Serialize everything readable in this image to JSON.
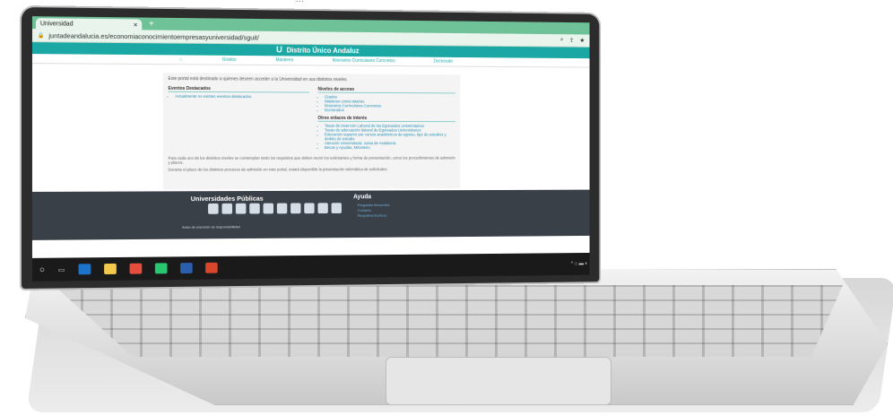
{
  "caption": "...",
  "browser": {
    "tab_title": "Universidad",
    "tab_close": "×",
    "new_tab": "+",
    "url": "juntadeandalucia.es/economiaconocimientoempresasyuniversidad/sguit/"
  },
  "site": {
    "title": "Distrito Único Andaluz",
    "nav": [
      "Grados",
      "Másteres",
      "Itinerarios Curriculares Concretos",
      "Doctorado"
    ],
    "intro": "Este portal está destinado a quienes deseen acceder a la Universidad en sus distintos niveles.",
    "left_heading": "Eventos Destacados",
    "left_items": [
      "Actualmente no existen eventos destacados."
    ],
    "right_heading": "Niveles de acceso",
    "right_items": [
      "Grados",
      "Másteres Universitarios",
      "Itinerarios Curriculares Concretos",
      "Doctorados"
    ],
    "other_heading": "Otros enlaces de interés",
    "other_items": [
      "Tasas de Inserción Laboral de los Egresados Universitarios",
      "Tasas de adecuación laboral de Egresados Universitarios",
      "Educación superior por cursos académicos de egreso, tipo de estudios y ámbito de estudio",
      "Atención Universitaria: Junta de Andalucía",
      "Becas y Ayudas, Ministerio"
    ],
    "note1": "Para cada uno de los distintos niveles se contemplan tanto los requisitos que deben reunir los solicitantes y forma de presentación, como los procedimientos de admisión y plazos.",
    "note2": "Durante el plazo de los distintos procesos de admisión en este portal, estará disponible la presentación telemática de solicitudes."
  },
  "footer": {
    "title": "Universidades Públicas",
    "help_title": "Ayuda",
    "help_links": [
      "Preguntas frecuentes",
      "Contacto",
      "Requisitos técnicos"
    ],
    "legal": "Aviso de exención de responsabilidad"
  }
}
